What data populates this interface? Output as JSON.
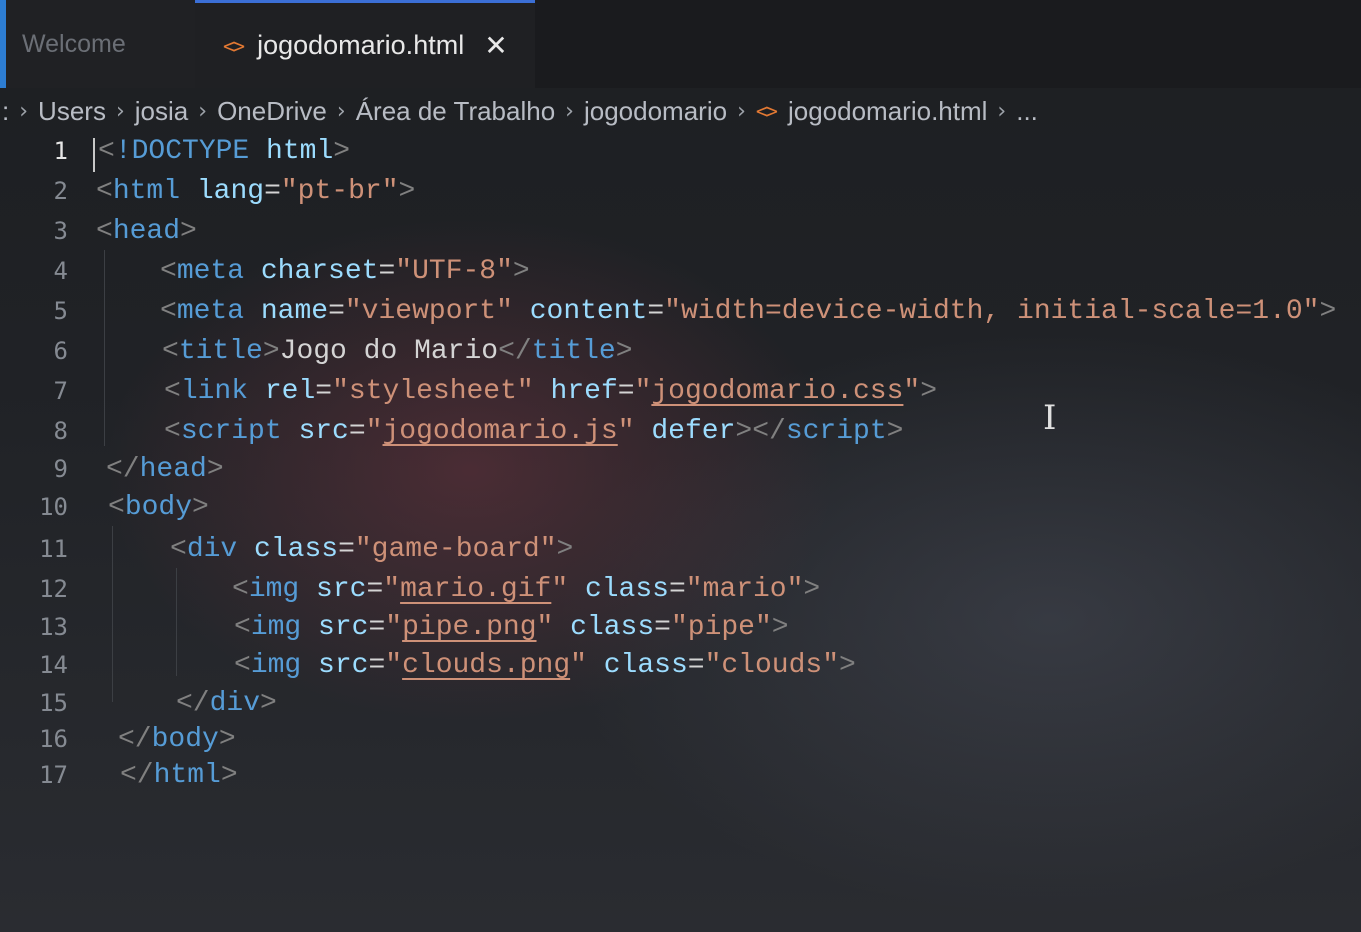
{
  "tabs": [
    {
      "label": "Welcome",
      "active": false
    },
    {
      "label": "jogodomario.html",
      "active": true,
      "icon": "html-file-icon",
      "close": "✕"
    }
  ],
  "breadcrumb": {
    "lead": ":",
    "items": [
      "Users",
      "josia",
      "OneDrive",
      "Área de Trabalho",
      "jogodomario",
      "jogodomario.html",
      "..."
    ],
    "separator": "›"
  },
  "editor": {
    "active_line": 1,
    "lines": [
      {
        "n": "1"
      },
      {
        "n": "2"
      },
      {
        "n": "3"
      },
      {
        "n": "4"
      },
      {
        "n": "5"
      },
      {
        "n": "6"
      },
      {
        "n": "7"
      },
      {
        "n": "8"
      },
      {
        "n": "9"
      },
      {
        "n": "10"
      },
      {
        "n": "11"
      },
      {
        "n": "12"
      },
      {
        "n": "13"
      },
      {
        "n": "14"
      },
      {
        "n": "15"
      },
      {
        "n": "16"
      },
      {
        "n": "17"
      }
    ],
    "tokens": {
      "l1_doctype": "!DOCTYPE",
      "l1_html": "html",
      "l2_tag": "html",
      "l2_attr": "lang",
      "l2_val": "\"pt-br\"",
      "l3_tag": "head",
      "l4_tag": "meta",
      "l4_attr": "charset",
      "l4_val": "\"UTF-8\"",
      "l5_tag": "meta",
      "l5_attr1": "name",
      "l5_val1": "\"viewport\"",
      "l5_attr2": "content",
      "l5_val2": "\"width=device-width, initial-scale=1.0\"",
      "l6_tag": "title",
      "l6_text": "Jogo do Mario",
      "l7_tag": "link",
      "l7_attr1": "rel",
      "l7_val1": "\"stylesheet\"",
      "l7_attr2": "href",
      "l7_q": "\"",
      "l7_link": "jogodomario.css",
      "l8_tag": "script",
      "l8_attr1": "src",
      "l8_q": "\"",
      "l8_link": "jogodomario.js",
      "l8_attr2": "defer",
      "l9_tag": "head",
      "l10_tag": "body",
      "l11_tag": "div",
      "l11_attr": "class",
      "l11_val": "\"game-board\"",
      "l12_tag": "img",
      "l12_attr1": "src",
      "l12_link": "mario.gif",
      "l12_attr2": "class",
      "l12_val2": "\"mario\"",
      "l13_tag": "img",
      "l13_attr1": "src",
      "l13_link": "pipe.png",
      "l13_attr2": "class",
      "l13_val2": "\"pipe\"",
      "l14_tag": "img",
      "l14_attr1": "src",
      "l14_link": "clouds.png",
      "l14_attr2": "class",
      "l14_val2": "\"clouds\"",
      "l15_tag": "div",
      "l16_tag": "body",
      "l17_tag": "html"
    }
  },
  "colors": {
    "tag": "#569cd6",
    "attribute": "#9cdcfe",
    "string": "#ce9178",
    "text": "#d4d4d4",
    "punctuation": "#808080",
    "tab_accent": "#3b6fd6",
    "html_icon": "#e37933"
  }
}
